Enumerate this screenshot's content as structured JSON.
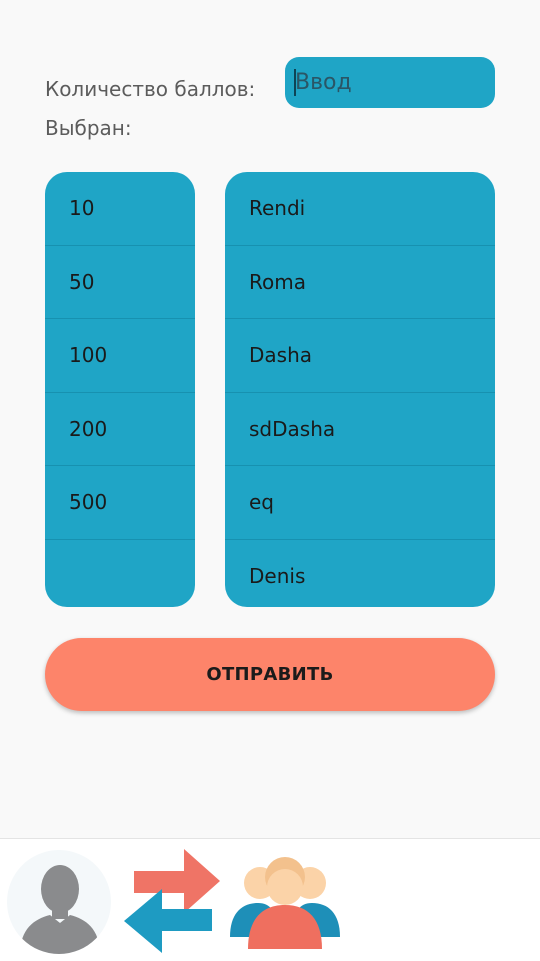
{
  "form": {
    "points_label": "Количество баллов:",
    "input_placeholder": "Ввод",
    "selected_label": "Выбран:"
  },
  "points": [
    "10",
    "50",
    "100",
    "200",
    "500",
    ""
  ],
  "names": [
    "Rendi",
    "Roma",
    "Dasha",
    "sdDasha",
    "eq",
    "Denis"
  ],
  "send_button": "ОТПРАВИТЬ",
  "nav": [
    "profile-icon",
    "transfer-icon",
    "group-icon"
  ],
  "colors": {
    "list_bg": "#1fa5c6",
    "button_bg": "#fd846a",
    "background": "#f9f9f9"
  }
}
